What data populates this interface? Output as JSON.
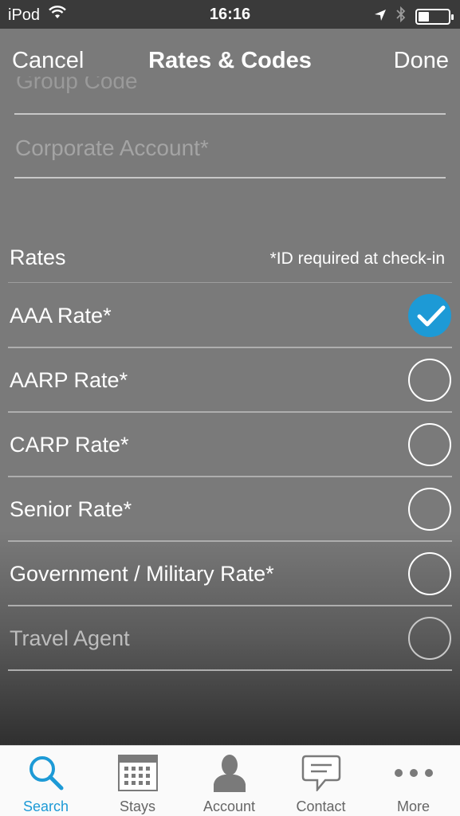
{
  "status_bar": {
    "carrier": "iPod",
    "time": "16:16",
    "battery_level": 0.35
  },
  "nav": {
    "cancel": "Cancel",
    "title": "Rates & Codes",
    "done": "Done"
  },
  "form": {
    "cutoff_field_label": "Group Code",
    "corporate_account_placeholder": "Corporate Account*"
  },
  "rates": {
    "header": "Rates",
    "note": "*ID required at check-in",
    "items": [
      {
        "label": "AAA Rate*",
        "selected": true,
        "enabled": true
      },
      {
        "label": "AARP Rate*",
        "selected": false,
        "enabled": true
      },
      {
        "label": "CARP Rate*",
        "selected": false,
        "enabled": true
      },
      {
        "label": "Senior Rate*",
        "selected": false,
        "enabled": true
      },
      {
        "label": "Government / Military Rate*",
        "selected": false,
        "enabled": true
      },
      {
        "label": "Travel Agent",
        "selected": false,
        "enabled": false
      }
    ]
  },
  "tabbar": {
    "items": [
      {
        "label": "Search",
        "icon": "search-icon",
        "active": true
      },
      {
        "label": "Stays",
        "icon": "calendar-icon",
        "active": false
      },
      {
        "label": "Account",
        "icon": "person-icon",
        "active": false
      },
      {
        "label": "Contact",
        "icon": "chat-bubble-icon",
        "active": false
      },
      {
        "label": "More",
        "icon": "more-dots-icon",
        "active": false
      }
    ]
  },
  "colors": {
    "accent": "#1d9ad6",
    "overlay": "#7a7a7a",
    "status_bar": "#3a3a3a",
    "tabbar": "#fafafa"
  }
}
